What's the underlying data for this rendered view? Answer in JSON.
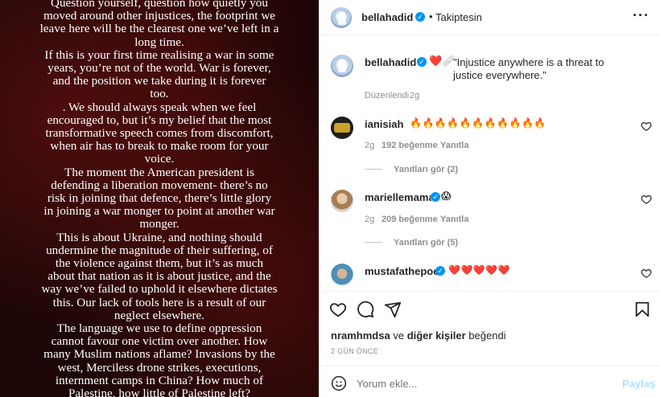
{
  "left_panel": {
    "text": "Question yourself, question how quietly you\nmoved around other injustices, the footprint we\nleave here will be the clearest one we’ve left in a\nlong time.\nIf this is your first time realising a war in some\nyears, you’re not of the world. War is forever,\nand the position we take during it is forever\ntoo.\n. We should always speak when we feel\nencouraged to, but it’s my belief that the most\ntransformative speech comes from discomfort,\nwhen air has to break to make room for your\nvoice.\nThe moment the American president is\ndefending a liberation movement- there’s no\nrisk in joining that defence, there’s little glory\nin joining a war monger to point at another war\nmonger.\nThis is about Ukraine, and nothing should\nundermine the magnitude of their suffering, of\nthe violence against them, but it’s as much\nabout that nation as it is about justice, and the\nway we’ve failed to uphold it elsewhere dictates\nthis. Our lack of tools here is a result of our\nneglect elsewhere.\nThe language we use to define oppression\ncannot favour one victim over another. How\nmany Muslim nations aflame? Invasions by the\nwest, Merciless drone strikes, executions,\ninternment camps in China? How much of\nPalestine, how little of Palestine left?"
  },
  "header": {
    "username": "bellahadid",
    "dot": "•",
    "follow_status": "Takiptesin",
    "more_icon": "more-horizontal-icon"
  },
  "caption": {
    "username": "bellahadid",
    "emojis": "❤️🩹",
    "text": "\"Injustice anywhere is a threat to justice everywhere.\"",
    "edited": "Düzenlendi",
    "time": "2g"
  },
  "comments": [
    {
      "username": "ianisiah",
      "verified": false,
      "text": "🔥🔥🔥🔥🔥🔥🔥🔥🔥🔥🔥",
      "time": "2g",
      "likes": "192 beğenme",
      "reply": "Yanıtla",
      "view_replies": "Yanıtları gör (2)"
    },
    {
      "username": "mariellemama",
      "verified": true,
      "text": "😱",
      "time": "2g",
      "likes": "209 beğenme",
      "reply": "Yanıtla",
      "view_replies": "Yanıtları gör (5)"
    },
    {
      "username": "mustafathepoet",
      "verified": true,
      "text": "❤️❤️❤️❤️❤️",
      "time": "",
      "likes": "",
      "reply": "",
      "view_replies": ""
    }
  ],
  "actions": {
    "like_icon": "heart-icon",
    "comment_icon": "comment-icon",
    "share_icon": "send-icon",
    "save_icon": "bookmark-icon"
  },
  "likes_line": {
    "user": "nramhmdsa",
    "connector": "ve",
    "others": "diğer kişiler",
    "suffix": "beğendi"
  },
  "post_time": "2 GÜN ÖNCE",
  "comment_box": {
    "emoji_icon": "emoji-icon",
    "placeholder": "Yorum ekle...",
    "post_button": "Paylaş"
  },
  "colors": {
    "accent": "#0095f6",
    "text": "#262626",
    "muted": "#8e8e8e",
    "like_red": "#ed4956"
  }
}
